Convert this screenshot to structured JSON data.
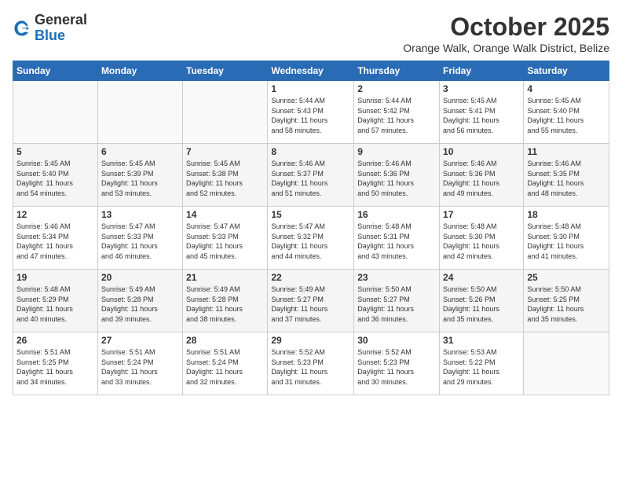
{
  "header": {
    "logo_general": "General",
    "logo_blue": "Blue",
    "month": "October 2025",
    "location": "Orange Walk, Orange Walk District, Belize"
  },
  "weekdays": [
    "Sunday",
    "Monday",
    "Tuesday",
    "Wednesday",
    "Thursday",
    "Friday",
    "Saturday"
  ],
  "weeks": [
    [
      {
        "day": "",
        "info": ""
      },
      {
        "day": "",
        "info": ""
      },
      {
        "day": "",
        "info": ""
      },
      {
        "day": "1",
        "info": "Sunrise: 5:44 AM\nSunset: 5:43 PM\nDaylight: 11 hours\nand 58 minutes."
      },
      {
        "day": "2",
        "info": "Sunrise: 5:44 AM\nSunset: 5:42 PM\nDaylight: 11 hours\nand 57 minutes."
      },
      {
        "day": "3",
        "info": "Sunrise: 5:45 AM\nSunset: 5:41 PM\nDaylight: 11 hours\nand 56 minutes."
      },
      {
        "day": "4",
        "info": "Sunrise: 5:45 AM\nSunset: 5:40 PM\nDaylight: 11 hours\nand 55 minutes."
      }
    ],
    [
      {
        "day": "5",
        "info": "Sunrise: 5:45 AM\nSunset: 5:40 PM\nDaylight: 11 hours\nand 54 minutes."
      },
      {
        "day": "6",
        "info": "Sunrise: 5:45 AM\nSunset: 5:39 PM\nDaylight: 11 hours\nand 53 minutes."
      },
      {
        "day": "7",
        "info": "Sunrise: 5:45 AM\nSunset: 5:38 PM\nDaylight: 11 hours\nand 52 minutes."
      },
      {
        "day": "8",
        "info": "Sunrise: 5:46 AM\nSunset: 5:37 PM\nDaylight: 11 hours\nand 51 minutes."
      },
      {
        "day": "9",
        "info": "Sunrise: 5:46 AM\nSunset: 5:36 PM\nDaylight: 11 hours\nand 50 minutes."
      },
      {
        "day": "10",
        "info": "Sunrise: 5:46 AM\nSunset: 5:36 PM\nDaylight: 11 hours\nand 49 minutes."
      },
      {
        "day": "11",
        "info": "Sunrise: 5:46 AM\nSunset: 5:35 PM\nDaylight: 11 hours\nand 48 minutes."
      }
    ],
    [
      {
        "day": "12",
        "info": "Sunrise: 5:46 AM\nSunset: 5:34 PM\nDaylight: 11 hours\nand 47 minutes."
      },
      {
        "day": "13",
        "info": "Sunrise: 5:47 AM\nSunset: 5:33 PM\nDaylight: 11 hours\nand 46 minutes."
      },
      {
        "day": "14",
        "info": "Sunrise: 5:47 AM\nSunset: 5:33 PM\nDaylight: 11 hours\nand 45 minutes."
      },
      {
        "day": "15",
        "info": "Sunrise: 5:47 AM\nSunset: 5:32 PM\nDaylight: 11 hours\nand 44 minutes."
      },
      {
        "day": "16",
        "info": "Sunrise: 5:48 AM\nSunset: 5:31 PM\nDaylight: 11 hours\nand 43 minutes."
      },
      {
        "day": "17",
        "info": "Sunrise: 5:48 AM\nSunset: 5:30 PM\nDaylight: 11 hours\nand 42 minutes."
      },
      {
        "day": "18",
        "info": "Sunrise: 5:48 AM\nSunset: 5:30 PM\nDaylight: 11 hours\nand 41 minutes."
      }
    ],
    [
      {
        "day": "19",
        "info": "Sunrise: 5:48 AM\nSunset: 5:29 PM\nDaylight: 11 hours\nand 40 minutes."
      },
      {
        "day": "20",
        "info": "Sunrise: 5:49 AM\nSunset: 5:28 PM\nDaylight: 11 hours\nand 39 minutes."
      },
      {
        "day": "21",
        "info": "Sunrise: 5:49 AM\nSunset: 5:28 PM\nDaylight: 11 hours\nand 38 minutes."
      },
      {
        "day": "22",
        "info": "Sunrise: 5:49 AM\nSunset: 5:27 PM\nDaylight: 11 hours\nand 37 minutes."
      },
      {
        "day": "23",
        "info": "Sunrise: 5:50 AM\nSunset: 5:27 PM\nDaylight: 11 hours\nand 36 minutes."
      },
      {
        "day": "24",
        "info": "Sunrise: 5:50 AM\nSunset: 5:26 PM\nDaylight: 11 hours\nand 35 minutes."
      },
      {
        "day": "25",
        "info": "Sunrise: 5:50 AM\nSunset: 5:25 PM\nDaylight: 11 hours\nand 35 minutes."
      }
    ],
    [
      {
        "day": "26",
        "info": "Sunrise: 5:51 AM\nSunset: 5:25 PM\nDaylight: 11 hours\nand 34 minutes."
      },
      {
        "day": "27",
        "info": "Sunrise: 5:51 AM\nSunset: 5:24 PM\nDaylight: 11 hours\nand 33 minutes."
      },
      {
        "day": "28",
        "info": "Sunrise: 5:51 AM\nSunset: 5:24 PM\nDaylight: 11 hours\nand 32 minutes."
      },
      {
        "day": "29",
        "info": "Sunrise: 5:52 AM\nSunset: 5:23 PM\nDaylight: 11 hours\nand 31 minutes."
      },
      {
        "day": "30",
        "info": "Sunrise: 5:52 AM\nSunset: 5:23 PM\nDaylight: 11 hours\nand 30 minutes."
      },
      {
        "day": "31",
        "info": "Sunrise: 5:53 AM\nSunset: 5:22 PM\nDaylight: 11 hours\nand 29 minutes."
      },
      {
        "day": "",
        "info": ""
      }
    ]
  ]
}
